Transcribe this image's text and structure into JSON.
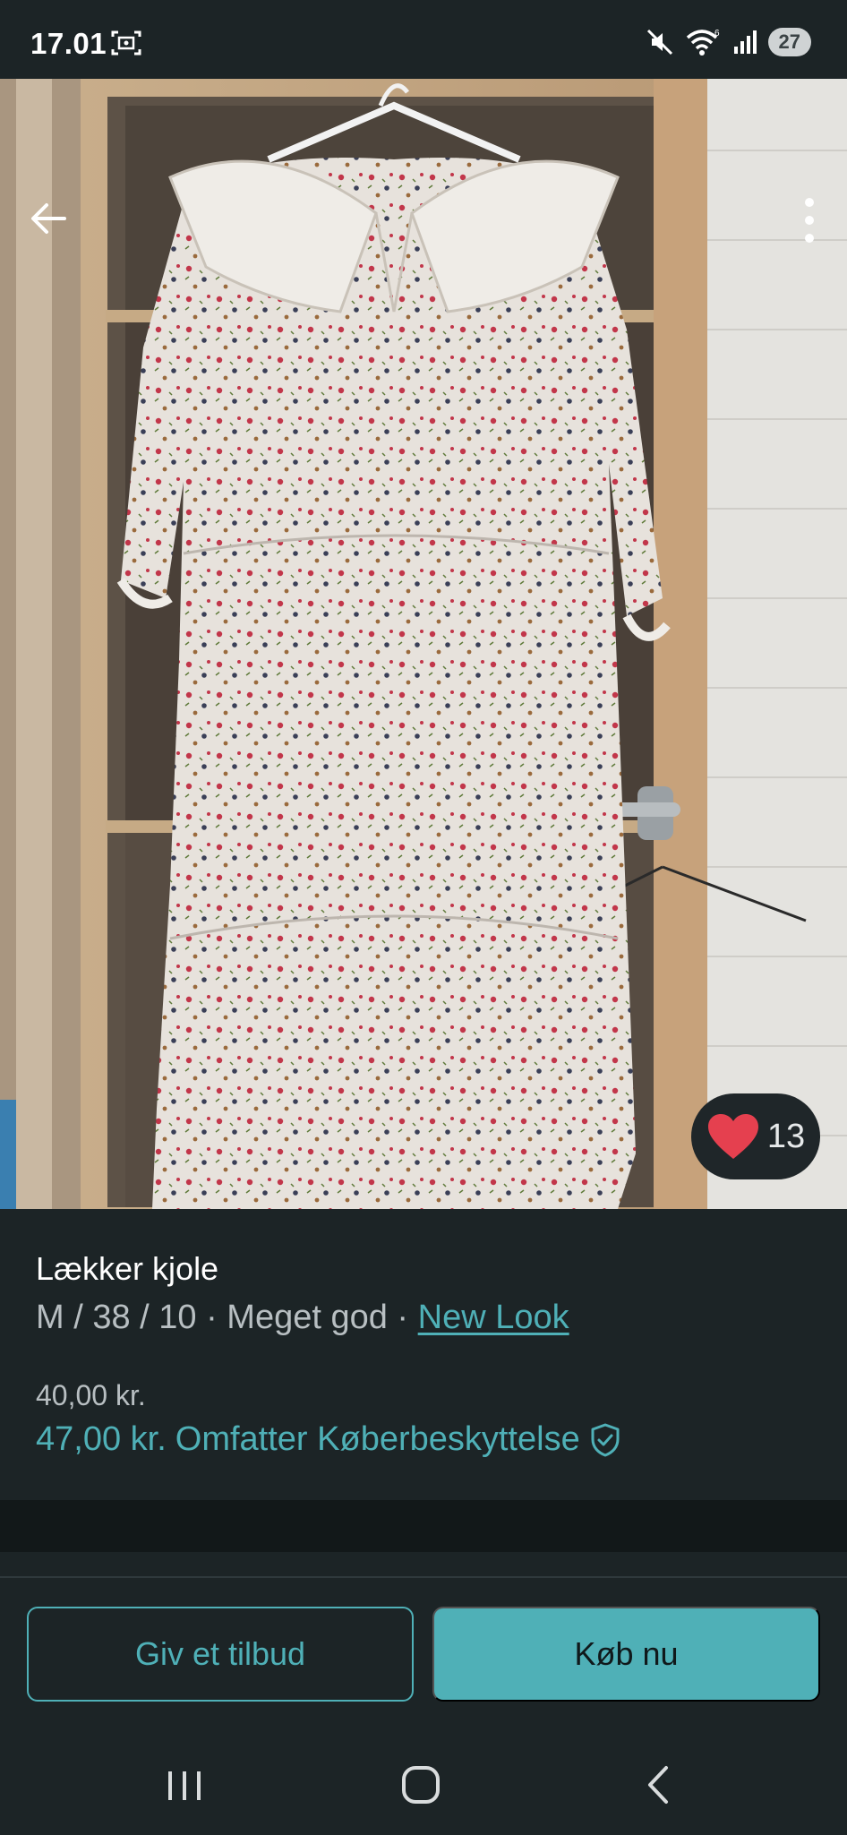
{
  "status_bar": {
    "time": "17.01",
    "battery": "27",
    "icons": [
      "screenshot-icon",
      "mute-icon",
      "wifi-icon",
      "signal-icon"
    ]
  },
  "photo": {
    "favourite_count": "13",
    "icons": [
      "back-arrow-icon",
      "more-vertical-icon",
      "heart-icon"
    ]
  },
  "item": {
    "title": "Lækker kjole",
    "meta_prefix": "M / 38 / 10 · Meget god · ",
    "brand": "New Look",
    "price": "40,00 kr.",
    "protected_price": "47,00 kr.",
    "protection_label": "Omfatter Køberbeskyttelse"
  },
  "actions": {
    "offer_label": "Giv et tilbud",
    "buy_label": "Køb nu"
  },
  "navbar": {
    "icons": [
      "recent-apps-icon",
      "home-icon",
      "back-icon"
    ]
  },
  "colors": {
    "accent": "#4fb0b7",
    "background": "#1c2426",
    "heart": "#e5404f"
  }
}
